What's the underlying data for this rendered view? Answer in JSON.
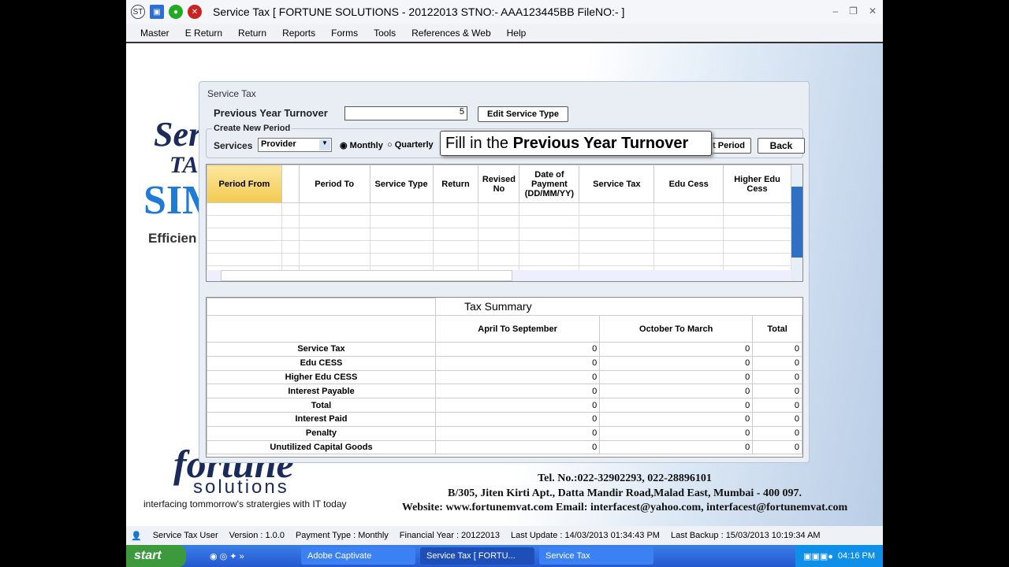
{
  "window": {
    "title": "Service Tax [ FORTUNE SOLUTIONS - 20122013 STNO:- AAA123445BB FileNO:- ]",
    "app_icon": "ST"
  },
  "menu": [
    "Master",
    "E Return",
    "Return",
    "Reports",
    "Forms",
    "Tools",
    "References & Web",
    "Help"
  ],
  "background": {
    "brand1": "Ser",
    "brand2": "TA",
    "brand3": "SIM",
    "tagline": "Efficien",
    "logo": "fortune",
    "logo_sub": "solutions",
    "slogan": "interfacing tommorrow's stratergies with IT today",
    "contact": [
      "Tel. No.:022-32902293, 022-28896101",
      "B/305, Jiten Kirti Apt., Datta Mandir Road,Malad East, Mumbai - 400 097.",
      "Website: www.fortunemvat.com  Email: interfacest@yahoo.com, interfacest@fortunemvat.com"
    ]
  },
  "dialog": {
    "title": "Service Tax",
    "turnover_label": "Previous Year Turnover",
    "turnover_value": "5",
    "edit_service_type": "Edit Service Type",
    "create_period": "Create New Period",
    "services_label": "Services",
    "services_value": "Provider",
    "monthly": "Monthly",
    "quarterly": "Quarterly",
    "edit_period": "it Period",
    "back": "Back",
    "tooltip_prefix": "Fill in the ",
    "tooltip_bold": "Previous Year Turnover",
    "columns": [
      "Period From",
      "",
      "Period To",
      "Service Type",
      "Return",
      "Revised No",
      "Date of Payment (DD/MM/YY)",
      "Service Tax",
      "Edu Cess",
      "Higher Edu Cess"
    ],
    "summary_title": "Tax Summary",
    "summary_cols": [
      "April To September",
      "October To March",
      "Total"
    ],
    "summary_rows": [
      {
        "label": "Service Tax",
        "v": [
          "0",
          "0",
          "0"
        ]
      },
      {
        "label": "Edu CESS",
        "v": [
          "0",
          "0",
          "0"
        ]
      },
      {
        "label": "Higher Edu CESS",
        "v": [
          "0",
          "0",
          "0"
        ]
      },
      {
        "label": "Interest Payable",
        "v": [
          "0",
          "0",
          "0"
        ]
      },
      {
        "label": "Total",
        "v": [
          "0",
          "0",
          "0"
        ]
      },
      {
        "label": "Interest Paid",
        "v": [
          "0",
          "0",
          "0"
        ]
      },
      {
        "label": "Penalty",
        "v": [
          "0",
          "0",
          "0"
        ]
      },
      {
        "label": "Unutilized Capital Goods",
        "v": [
          "0",
          "0",
          "0"
        ]
      }
    ]
  },
  "status": [
    "Service Tax User",
    "Version : 1.0.0",
    "Payment Type : Monthly",
    "Financial Year : 20122013",
    "Last Update : 14/03/2013 01:34:43 PM",
    "Last Backup : 15/03/2013 10:19:34 AM"
  ],
  "taskbar": {
    "start": "start",
    "tasks": [
      "Adobe Captivate",
      "Service Tax [ FORTU...",
      "Service Tax"
    ],
    "clock": "04:16 PM"
  }
}
